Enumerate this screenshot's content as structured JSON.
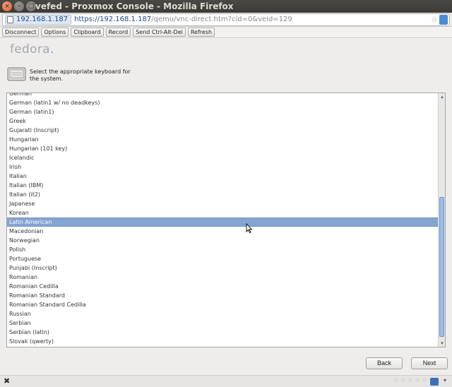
{
  "window": {
    "title": "vefed - Proxmox Console - Mozilla Firefox",
    "close_glyph": "×",
    "minimize_glyph": "–",
    "maximize_glyph": "□"
  },
  "urlbar": {
    "site_identity": "192.168.1.187",
    "url_host": "https://192.168.1.187",
    "url_path": "/qemu/vnc-direct.htm?cid=0&veid=129"
  },
  "vnc_toolbar": {
    "buttons": [
      "Disconnect",
      "Options",
      "Clipboard",
      "Record",
      "Send Ctrl-Alt-Del",
      "Refresh"
    ]
  },
  "installer": {
    "logo_text": "fedora",
    "logo_dot": ".",
    "instruction": "Select the appropriate keyboard for the system.",
    "keyboard_layouts": [
      "German",
      "German (latin1 w/ no deadkeys)",
      "German (latin1)",
      "Greek",
      "Gujarati (Inscript)",
      "Hungarian",
      "Hungarian (101 key)",
      "Icelandic",
      "Irish",
      "Italian",
      "Italian (IBM)",
      "Italian (it2)",
      "Japanese",
      "Korean",
      "Latin American",
      "Macedonian",
      "Norwegian",
      "Polish",
      "Portuguese",
      "Punjabi (Inscript)",
      "Romanian",
      "Romanian Cedilla",
      "Romanian Standard",
      "Romanian Standard Cedilla",
      "Russian",
      "Serbian",
      "Serbian (latin)",
      "Slovak (qwerty)"
    ],
    "selected_layout": "Latin American",
    "back_label": "Back",
    "next_label": "Next"
  },
  "statusbar": {
    "close_glyph": "✖",
    "rating_stars": 5
  },
  "colors": {
    "selection": "#86a4d0",
    "scroll_thumb": "#9cbde6",
    "titlebar": "#3c3b37"
  }
}
